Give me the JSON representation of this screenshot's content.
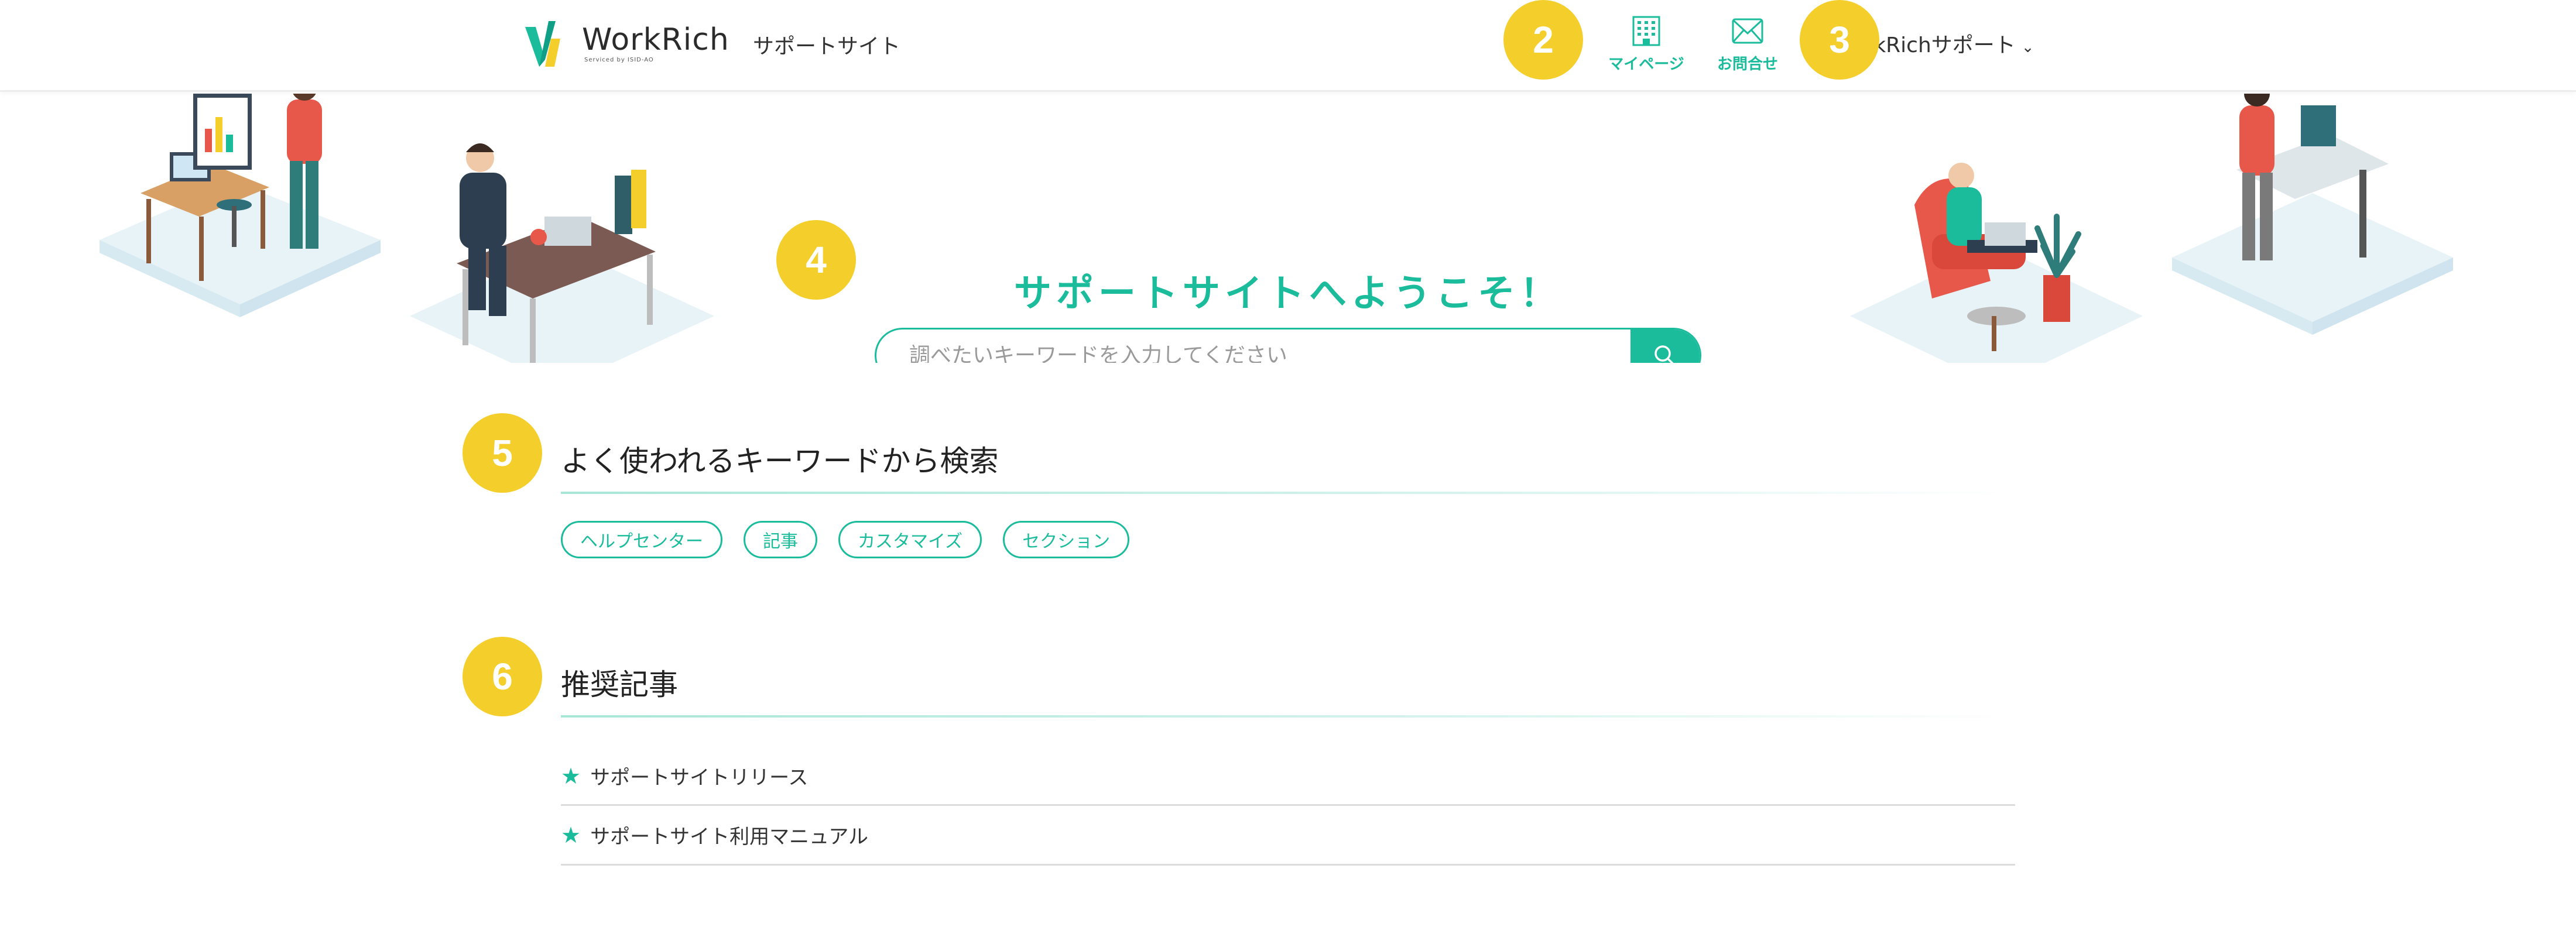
{
  "header": {
    "logo_text": "WorkRich",
    "logo_sub": "Serviced by ISID-AO",
    "site_name": "サポートサイト",
    "nav": {
      "mypage_label": "マイページ",
      "contact_label": "お問合せ"
    },
    "user_menu_label": "WorkRichサポート"
  },
  "badges": [
    "2",
    "3",
    "4",
    "5",
    "6"
  ],
  "hero": {
    "title": "サポートサイトへようこそ！",
    "search_placeholder": "調べたいキーワードを入力してください"
  },
  "keywords": {
    "title": "よく使われるキーワードから検索",
    "tags": [
      "ヘルプセンター",
      "記事",
      "カスタマイズ",
      "セクション"
    ]
  },
  "recommended": {
    "title": "推奨記事",
    "articles": [
      "サポートサイトリリース",
      "サポートサイト利用マニュアル"
    ]
  },
  "colors": {
    "accent": "#1abc9c",
    "badge": "#f4ce2a"
  },
  "icons": [
    "building-icon",
    "mail-icon",
    "chevron-down-icon",
    "search-icon",
    "star-icon"
  ]
}
